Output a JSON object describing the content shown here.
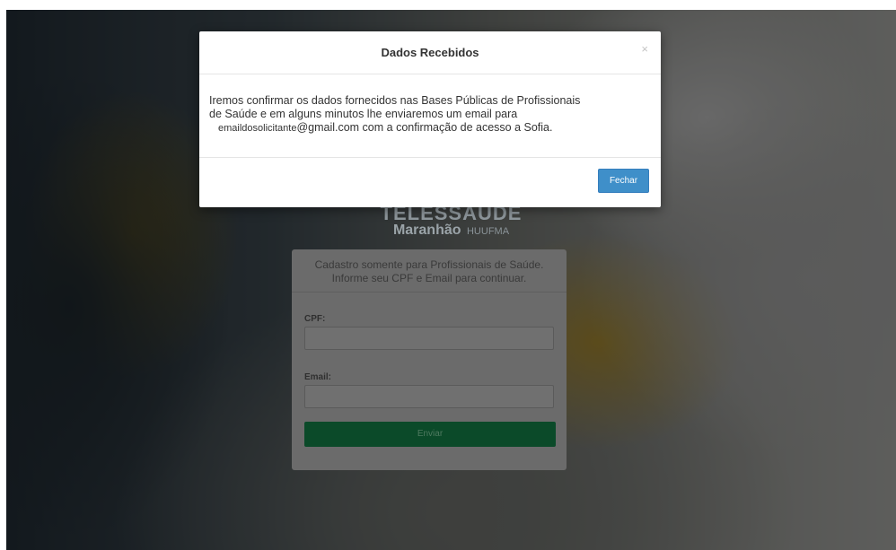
{
  "brand": {
    "line1": "TELESSAÚDE",
    "line2": "Maranhão",
    "line2_sub": "HUUFMA"
  },
  "form": {
    "intro_line1": "Cadastro somente para Profissionais de Saúde.",
    "intro_line2": "Informe seu CPF e Email para continuar.",
    "cpf_label": "CPF:",
    "cpf_value": "",
    "email_label": "Email:",
    "email_value": "",
    "submit_label": "Enviar"
  },
  "modal": {
    "title": "Dados Recebidos",
    "close_symbol": "×",
    "message_line1": "Iremos confirmar os dados fornecidos nas Bases Públicas de Profissionais",
    "message_line2": "de Saúde e em alguns minutos lhe enviaremos um email para",
    "message_email": "emaildosolicitante",
    "message_tail": "@gmail.com com a confirmação de acesso a Sofia.",
    "close_button_label": "Fechar"
  },
  "colors": {
    "primary_button": "#3f8fc9",
    "submit_button": "#0b4a29"
  }
}
